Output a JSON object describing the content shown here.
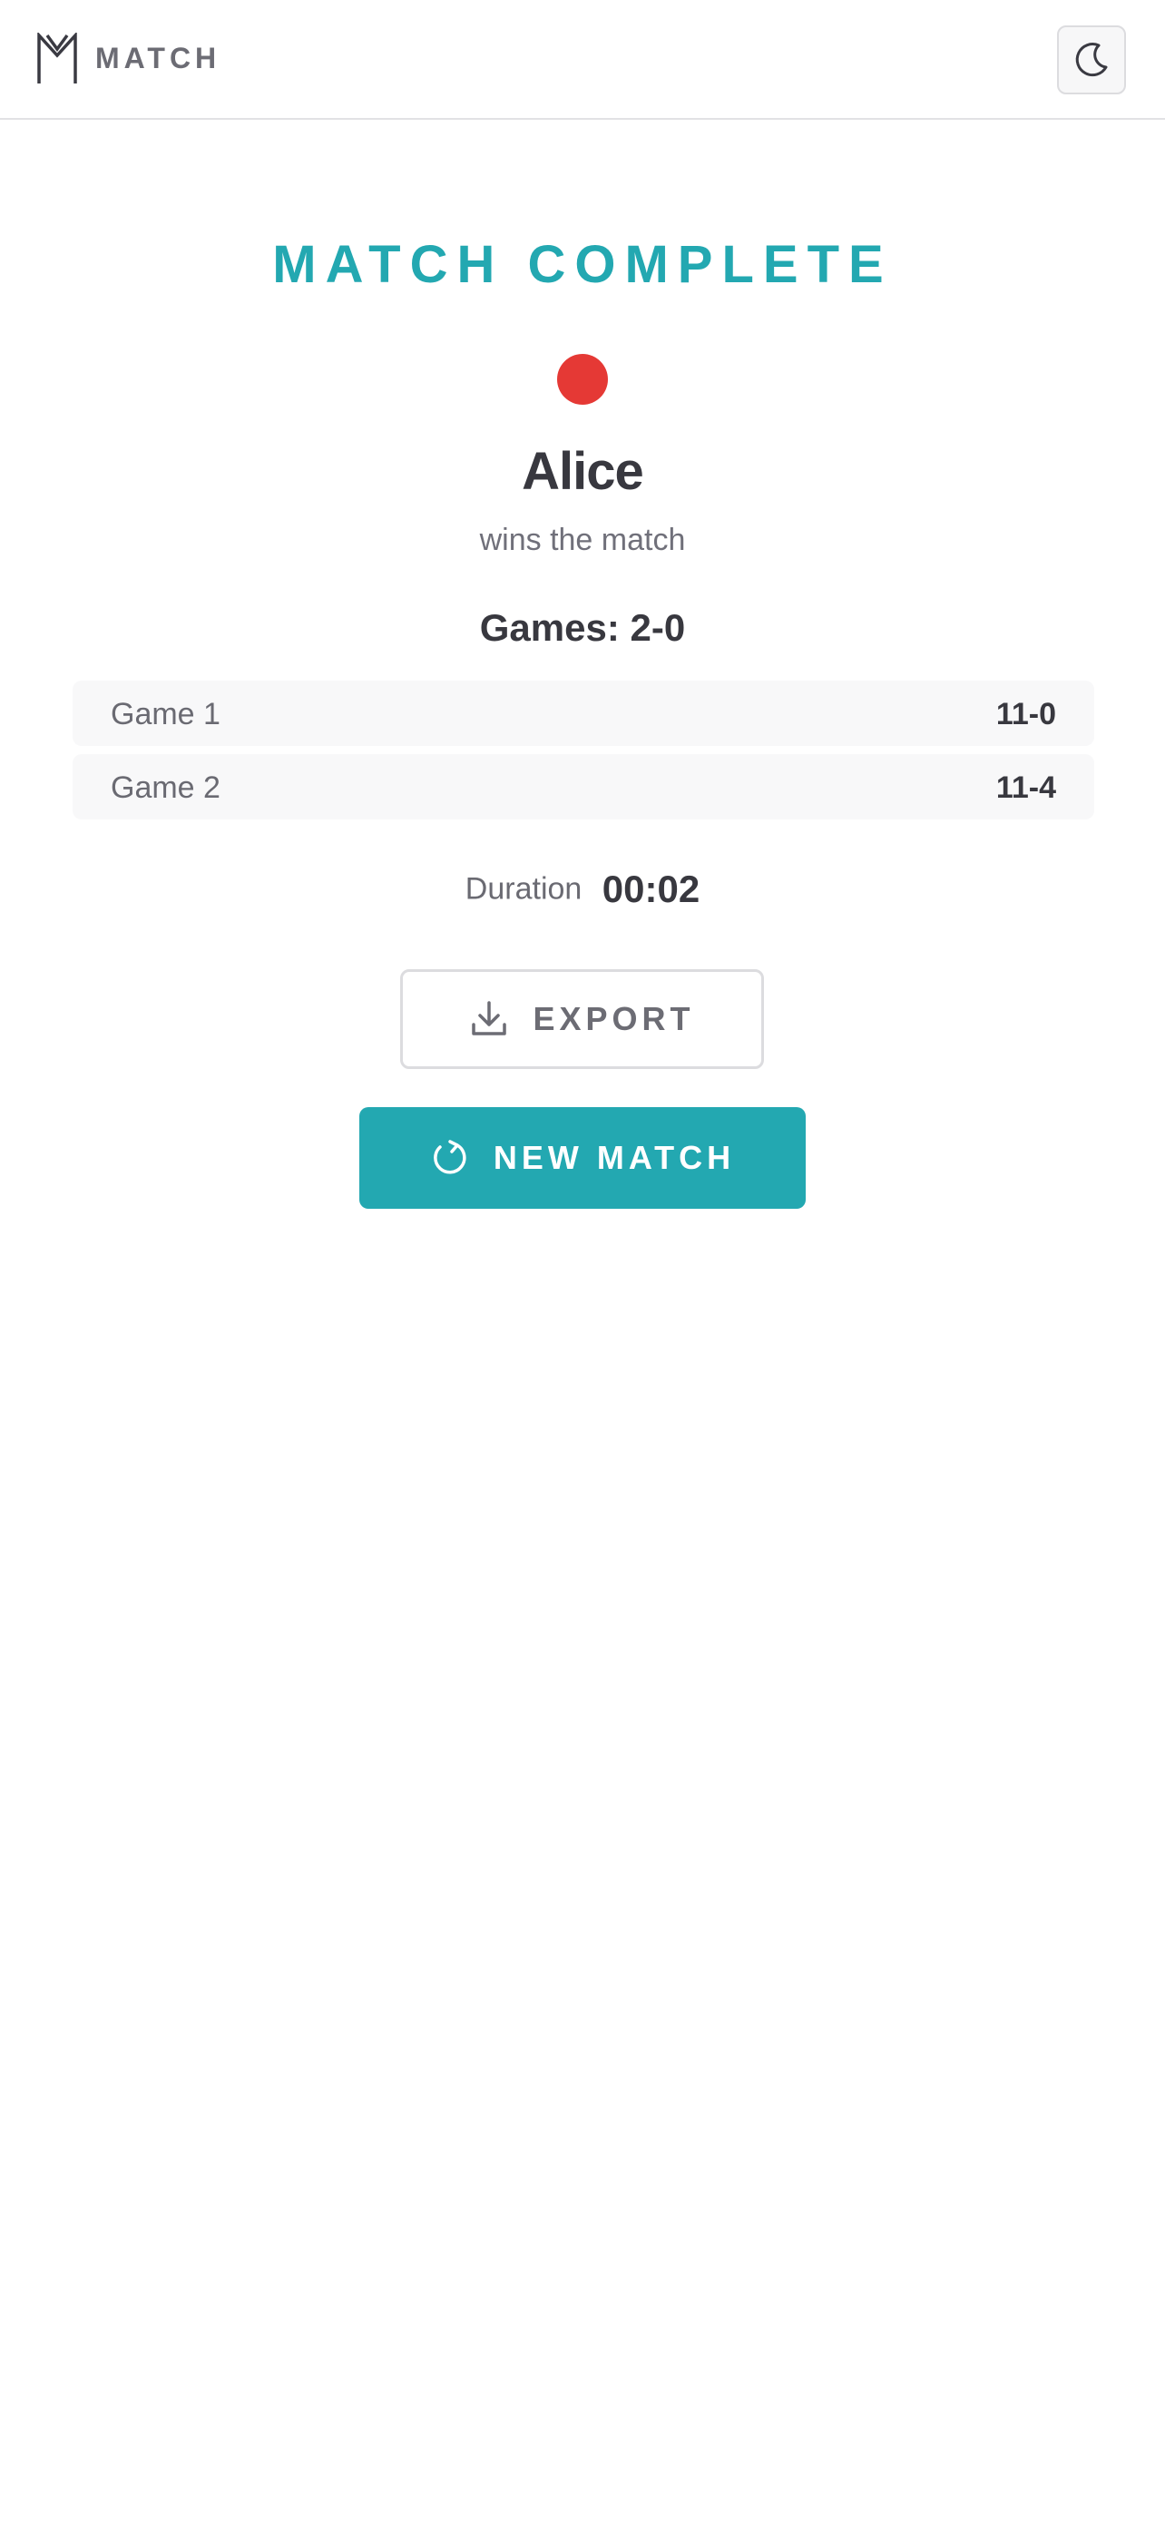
{
  "header": {
    "brand": "MATCH",
    "logo_icon": "m-logo-icon",
    "theme_toggle_icon": "moon-icon"
  },
  "result": {
    "title": "MATCH COMPLETE",
    "winner_color": "#e53935",
    "winner_name": "Alice",
    "subtitle": "wins the match",
    "games_summary": "Games: 2-0"
  },
  "games": [
    {
      "label": "Game 1",
      "score": "11-0"
    },
    {
      "label": "Game 2",
      "score": "11-4"
    }
  ],
  "duration": {
    "label": "Duration",
    "value": "00:02"
  },
  "actions": {
    "export_label": "EXPORT",
    "export_icon": "download-icon",
    "new_match_label": "NEW MATCH",
    "new_match_icon": "refresh-icon"
  },
  "colors": {
    "accent": "#23a8b1",
    "winner_dot": "#e53935"
  }
}
